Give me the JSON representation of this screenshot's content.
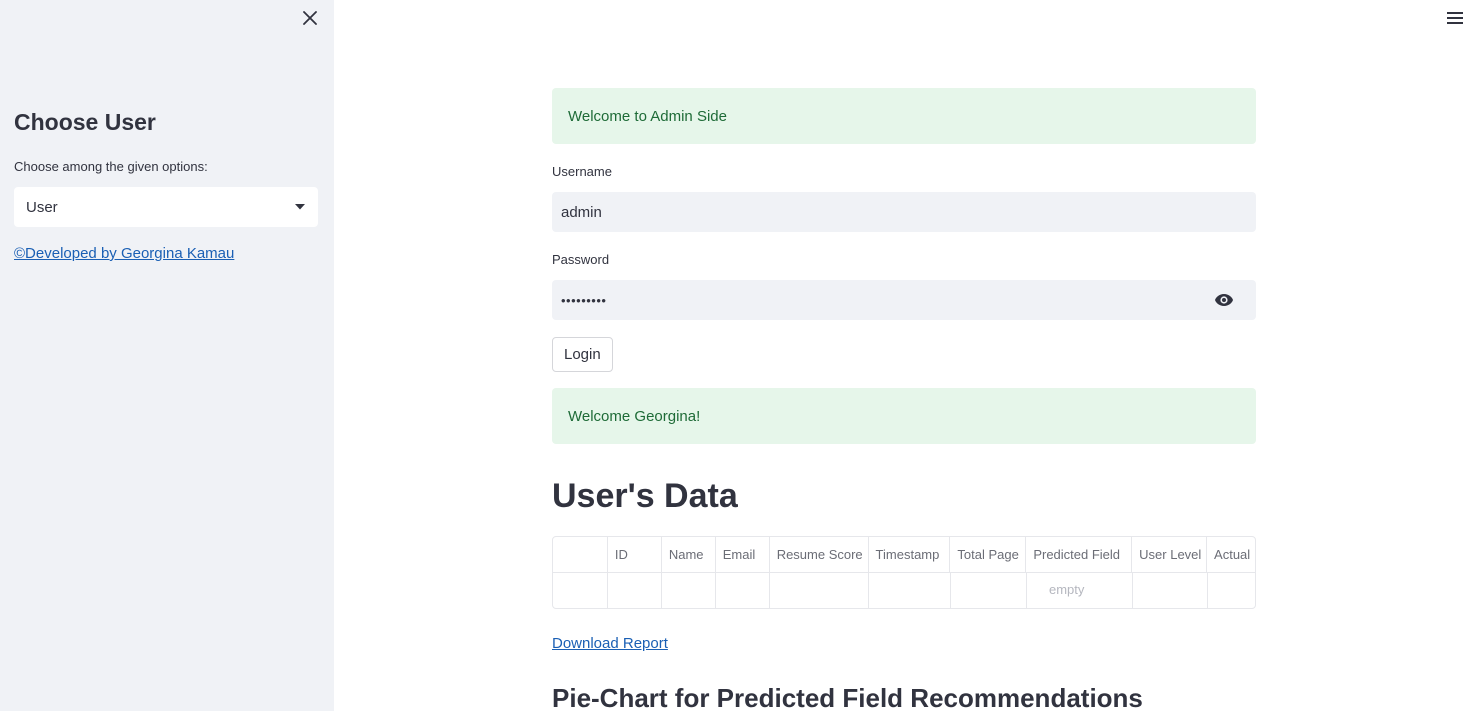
{
  "sidebar": {
    "title": "Choose User",
    "select_label": "Choose among the given options:",
    "selected_option": "User",
    "credit_link": "©Developed by Georgina Kamau"
  },
  "main": {
    "admin_alert": "Welcome to Admin Side",
    "username_label": "Username",
    "username_value": "admin",
    "password_label": "Password",
    "password_masked": "•••••••••",
    "login_button": "Login",
    "welcome_alert": "Welcome Georgina!",
    "users_heading": "User's Data",
    "table": {
      "columns": [
        "",
        "ID",
        "Name",
        "Email",
        "Resume Score",
        "Timestamp",
        "Total Page",
        "Predicted Field",
        "User Level",
        "Actual"
      ],
      "empty_text": "empty"
    },
    "download_link": "Download Report",
    "pie_heading": "Pie-Chart for Predicted Field Recommendations"
  },
  "colors": {
    "sidebar_bg": "#f0f2f6",
    "success_bg": "#e6f6ea",
    "success_text": "#1e6b37",
    "link": "#1a5fb4",
    "text": "#31333f"
  },
  "icons": {
    "close": "close-icon",
    "dropdown": "caret-down-icon",
    "eye": "eye-icon",
    "menu": "hamburger-menu-icon"
  }
}
